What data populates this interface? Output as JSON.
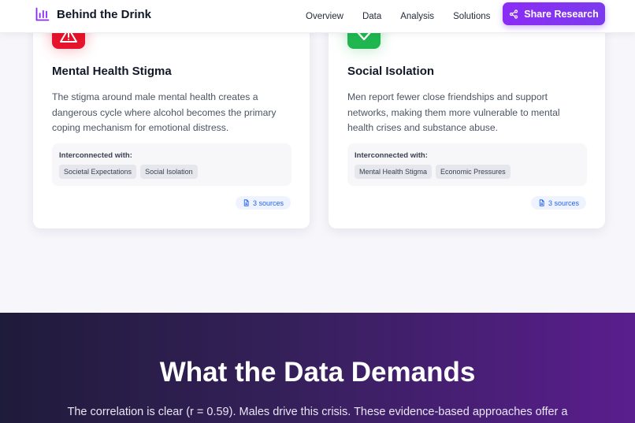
{
  "nav": {
    "brand": "Behind the Drink",
    "links": [
      "Overview",
      "Data",
      "Analysis",
      "Solutions"
    ],
    "share_label": "Share Research"
  },
  "cards": [
    {
      "title": "Mental Health Stigma",
      "icon": "warning-icon",
      "icon_color": "#e5132b",
      "description": "The stigma around male mental health creates a dangerous cycle where alcohol becomes the primary coping mechanism for emotional distress.",
      "interconnected_label": "Interconnected with:",
      "tags": [
        "Societal Expectations",
        "Social Isolation"
      ],
      "sources": "3 sources"
    },
    {
      "title": "Social Isolation",
      "icon": "check-icon",
      "icon_color": "#1fb64f",
      "description": "Men report fewer close friendships and support networks, making them more vulnerable to mental health crises and substance abuse.",
      "interconnected_label": "Interconnected with:",
      "tags": [
        "Mental Health Stigma",
        "Economic Pressures"
      ],
      "sources": "3 sources"
    }
  ],
  "demands": {
    "title": "What the Data Demands",
    "subtitle": "The correlation is clear (r = 0.59). Males drive this crisis. These evidence-based approaches offer a"
  },
  "colors": {
    "accent": "#7c3aed",
    "link": "#2563eb"
  }
}
